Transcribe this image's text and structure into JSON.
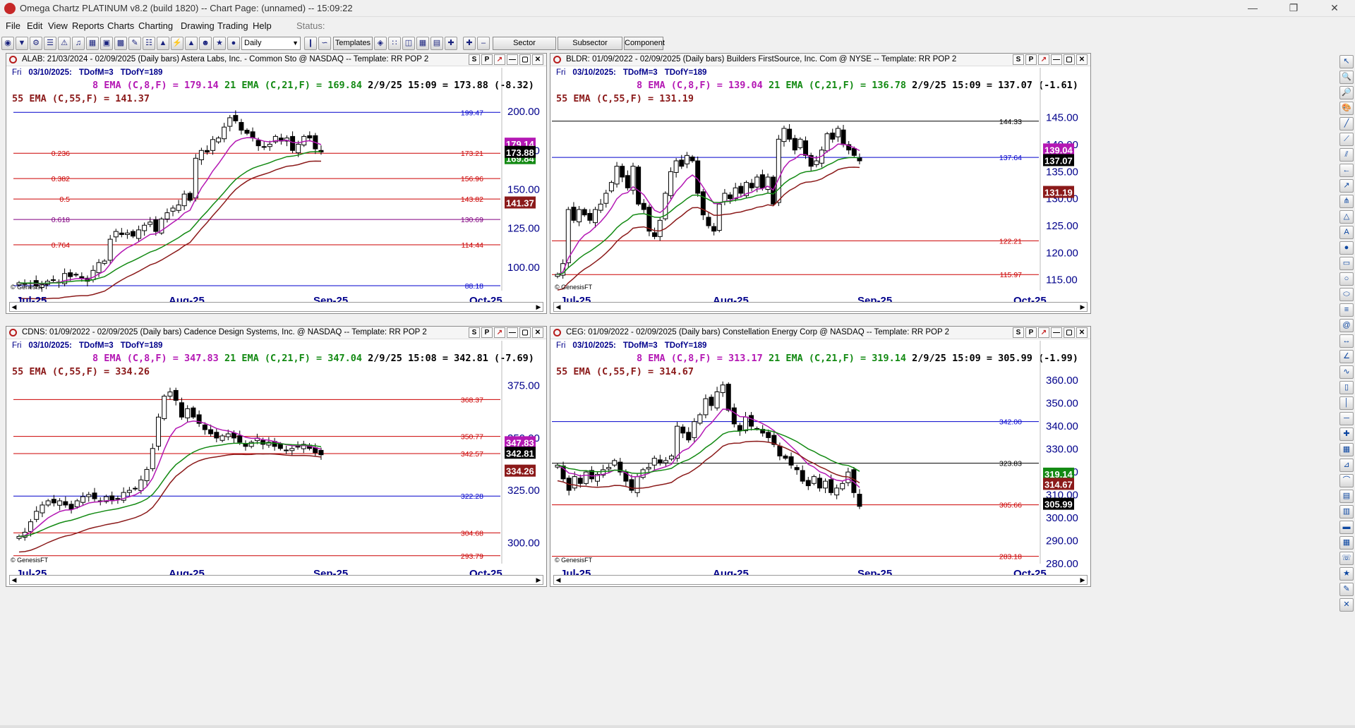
{
  "window": {
    "title": "Omega Chartz PLATINUM v8.2 (build 1820)  --  Chart Page: (unnamed)  --  15:09:22"
  },
  "menu": [
    "File",
    "Edit",
    "View",
    "Reports",
    "Charts",
    "Charting",
    "Drawing",
    "Trading",
    "Help"
  ],
  "status_label": "Status:",
  "toolbar": {
    "period": "Daily",
    "templates": "Templates",
    "sector": "Sector",
    "subsector": "Subsector",
    "component": "Component"
  },
  "colors": {
    "ema8": "#b418b4",
    "ema21": "#138a13",
    "ema55": "#8b1a1a",
    "blue_line": "#0000cc",
    "red_line": "#cc0000"
  },
  "charts": [
    {
      "id": "alab",
      "header": "ALAB: 21/03/2024 - 02/09/2025  (Daily bars)  Astera Labs, Inc. - Common Sto @ NASDAQ  --  Template: RR POP 2",
      "date_line": {
        "fri": "Fri",
        "date": "03/10/2025:",
        "tdm": "TDofM=3",
        "tdy": "TDofY=189"
      },
      "ema8": "8 EMA (C,8,F) = 179.14",
      "ema21": "21 EMA (C,21,F) = 169.84",
      "price": "2/9/25 15:09 = 173.88 (-8.32)",
      "ema55": "55 EMA (C,55,F) = 141.37",
      "yaxis": {
        "min": 85,
        "max": 210,
        "labels": [
          "200.00",
          "175.00",
          "150.00",
          "125.00",
          "100.00"
        ],
        "ticks": [
          200,
          175,
          150,
          125,
          100
        ]
      },
      "hlines": [
        {
          "value": 199.47,
          "label": "199.47",
          "color": "#0000cc"
        },
        {
          "value": 173.21,
          "label": "173.21",
          "color": "#cc0000",
          "fib": "0.236"
        },
        {
          "value": 156.96,
          "label": "156.96",
          "color": "#cc0000",
          "fib": "0.382"
        },
        {
          "value": 143.82,
          "label": "143.82",
          "color": "#cc0000",
          "fib": "0.5"
        },
        {
          "value": 130.69,
          "label": "130.69",
          "color": "#800080",
          "fib": "0.618"
        },
        {
          "value": 114.44,
          "label": "114.44",
          "color": "#cc0000",
          "fib": "0.764"
        },
        {
          "value": 88.18,
          "label": "88.18",
          "color": "#0000cc"
        }
      ],
      "badges": [
        {
          "text": "179.14",
          "bg": "#b418b4",
          "value": 179.14
        },
        {
          "text": "169.84",
          "bg": "#138a13",
          "value": 169.84
        },
        {
          "text": "141.37",
          "bg": "#8b1a1a",
          "value": 141.37
        },
        {
          "text": "173.88",
          "bg": "#000000",
          "value": 173.88
        }
      ],
      "xaxis": [
        "Jul-25",
        "Aug-25",
        "Sep-25",
        "Oct-25"
      ],
      "genesis": "© GenesisFT"
    },
    {
      "id": "bldr",
      "header": "BLDR: 01/09/2022 - 02/09/2025  (Daily bars)  Builders FirstSource, Inc. Com @ NYSE  --  Template: RR POP 2",
      "date_line": {
        "fri": "Fri",
        "date": "03/10/2025:",
        "tdm": "TDofM=3",
        "tdy": "TDofY=189"
      },
      "ema8": "8 EMA (C,8,F) = 139.04",
      "ema21": "21 EMA (C,21,F) = 136.78",
      "price": "2/9/25 15:09 = 137.07 (-1.61)",
      "ema55": "55 EMA (C,55,F) = 131.19",
      "yaxis": {
        "min": 113,
        "max": 149,
        "labels": [
          "145.00",
          "140.00",
          "135.00",
          "130.00",
          "125.00",
          "120.00",
          "115.00"
        ],
        "ticks": [
          145,
          140,
          135,
          130,
          125,
          120,
          115
        ]
      },
      "hlines": [
        {
          "value": 144.33,
          "label": "144.33",
          "color": "#000000"
        },
        {
          "value": 137.64,
          "label": "137.64",
          "color": "#0000cc"
        },
        {
          "value": 122.21,
          "label": "122.21",
          "color": "#cc0000"
        },
        {
          "value": 115.97,
          "label": "115.97",
          "color": "#cc0000"
        }
      ],
      "badges": [
        {
          "text": "139.04",
          "bg": "#b418b4",
          "value": 139.04
        },
        {
          "text": "137.07",
          "bg": "#000000",
          "value": 137.07
        },
        {
          "text": "131.19",
          "bg": "#8b1a1a",
          "value": 131.19
        }
      ],
      "xaxis": [
        "Jul-25",
        "Aug-25",
        "Sep-25",
        "Oct-25"
      ],
      "genesis": "© GenesisFT"
    },
    {
      "id": "cdns",
      "header": "CDNS: 01/09/2022 - 02/09/2025  (Daily bars)  Cadence Design Systems, Inc. @ NASDAQ  --  Template: RR POP 2",
      "date_line": {
        "fri": "Fri",
        "date": "03/10/2025:",
        "tdm": "TDofM=3",
        "tdy": "TDofY=189"
      },
      "ema8": "8 EMA (C,8,F) = 347.83",
      "ema21": "21 EMA (C,21,F) = 347.04",
      "price": "2/9/25 15:08 = 342.81 (-7.69)",
      "ema55": "55 EMA (C,55,F) = 334.26",
      "yaxis": {
        "min": 290,
        "max": 383,
        "labels": [
          "375.00",
          "350.00",
          "325.00",
          "300.00"
        ],
        "ticks": [
          375,
          350,
          325,
          300
        ]
      },
      "hlines": [
        {
          "value": 368.37,
          "label": "368.37",
          "color": "#cc0000"
        },
        {
          "value": 350.77,
          "label": "350.77",
          "color": "#cc0000"
        },
        {
          "value": 342.57,
          "label": "342.57",
          "color": "#cc0000"
        },
        {
          "value": 322.28,
          "label": "322.28",
          "color": "#0000cc"
        },
        {
          "value": 304.68,
          "label": "304.68",
          "color": "#cc0000"
        },
        {
          "value": 293.79,
          "label": "293.79",
          "color": "#cc0000"
        }
      ],
      "badges": [
        {
          "text": "347.83",
          "bg": "#b418b4",
          "value": 347.83
        },
        {
          "text": "342.81",
          "bg": "#000000",
          "value": 342.81
        },
        {
          "text": "334.26",
          "bg": "#8b1a1a",
          "value": 334.26
        }
      ],
      "xaxis": [
        "Jul-25",
        "Aug-25",
        "Sep-25",
        "Oct-25"
      ],
      "genesis": "© GenesisFT"
    },
    {
      "id": "ceg",
      "header": "CEG: 01/09/2022 - 02/09/2025  (Daily bars)  Constellation Energy Corp @ NASDAQ  --  Template: RR POP 2",
      "date_line": {
        "fri": "Fri",
        "date": "03/10/2025:",
        "tdm": "TDofM=3",
        "tdy": "TDofY=189"
      },
      "ema8": "8 EMA (C,8,F) = 313.17",
      "ema21": "21 EMA (C,21,F) = 319.14",
      "price": "2/9/25 15:09 = 305.99 (-1.99)",
      "ema55": "55 EMA (C,55,F) = 314.67",
      "yaxis": {
        "min": 280,
        "max": 365,
        "labels": [
          "360.00",
          "350.00",
          "340.00",
          "330.00",
          "320.00",
          "310.00",
          "300.00",
          "290.00",
          "280.00"
        ],
        "ticks": [
          360,
          350,
          340,
          330,
          320,
          310,
          300,
          290,
          280
        ]
      },
      "hlines": [
        {
          "value": 342.0,
          "label": "342.00",
          "color": "#0000cc"
        },
        {
          "value": 323.83,
          "label": "323.83",
          "color": "#000000"
        },
        {
          "value": 305.66,
          "label": "305.66",
          "color": "#cc0000"
        },
        {
          "value": 283.18,
          "label": "283.18",
          "color": "#cc0000"
        }
      ],
      "badges": [
        {
          "text": "319.14",
          "bg": "#138a13",
          "value": 319.14
        },
        {
          "text": "314.67",
          "bg": "#8b1a1a",
          "value": 314.67
        },
        {
          "text": "305.99",
          "bg": "#000000",
          "value": 305.99
        }
      ],
      "xaxis": [
        "Jul-25",
        "Aug-25",
        "Sep-25",
        "Oct-25"
      ],
      "genesis": "© GenesisFT"
    }
  ]
}
